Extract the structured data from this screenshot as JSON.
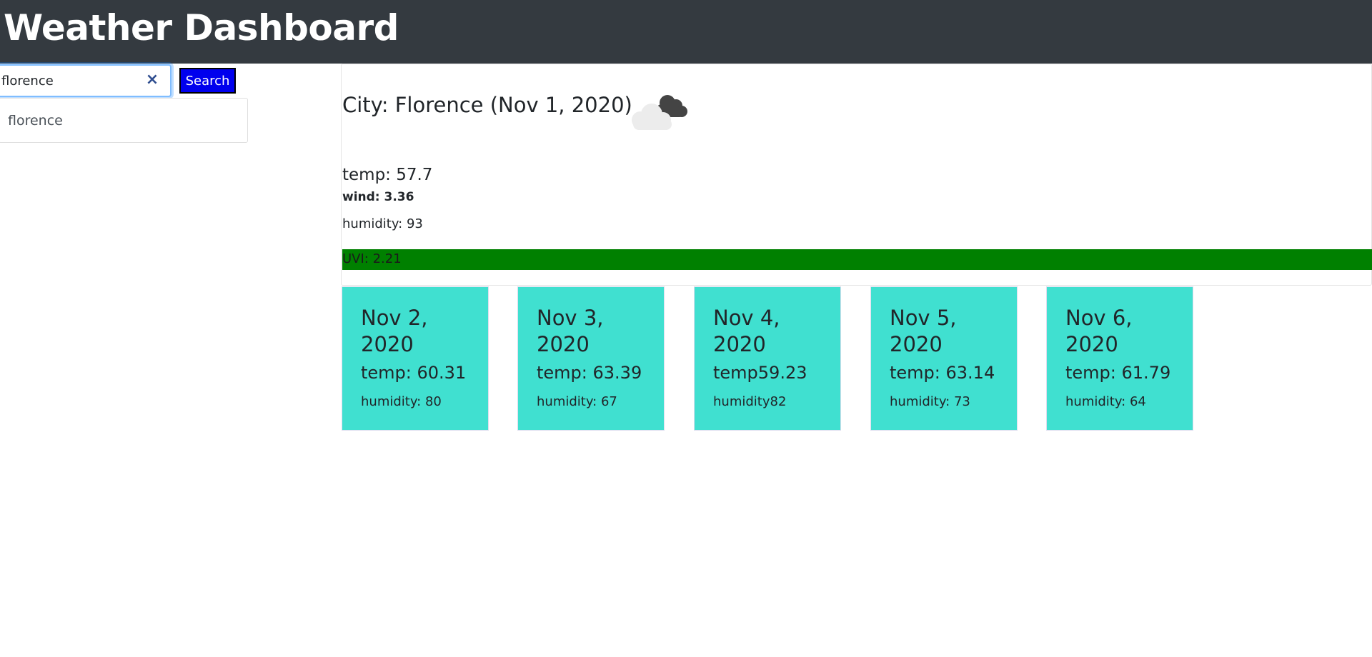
{
  "header": {
    "title": "Weather Dashboard"
  },
  "search": {
    "value": "florence",
    "clear_icon": "×",
    "button_label": "Search"
  },
  "history": {
    "items": [
      "florence"
    ]
  },
  "current": {
    "city_line": "City: Florence (Nov 1, 2020)",
    "icon": "broken-clouds-icon",
    "temp": "temp: 57.7",
    "wind": "wind: 3.36",
    "humidity": "humidity: 93",
    "uvi": "UVI: 2.21",
    "uvi_color": "#008000"
  },
  "forecast": [
    {
      "date": "Nov 2, 2020",
      "temp": "temp: 60.31",
      "humidity": "humidity: 80"
    },
    {
      "date": "Nov 3, 2020",
      "temp": "temp: 63.39",
      "humidity": "humidity: 67"
    },
    {
      "date": "Nov 4, 2020",
      "temp": "temp59.23",
      "humidity": "humidity82"
    },
    {
      "date": "Nov 5, 2020",
      "temp": "temp: 63.14",
      "humidity": "humidity: 73"
    },
    {
      "date": "Nov 6, 2020",
      "temp": "temp: 61.79",
      "humidity": "humidity: 64"
    }
  ],
  "colors": {
    "navbar": "#343a40",
    "search_button": "#0000ee",
    "forecast_card": "#40e0d0"
  }
}
